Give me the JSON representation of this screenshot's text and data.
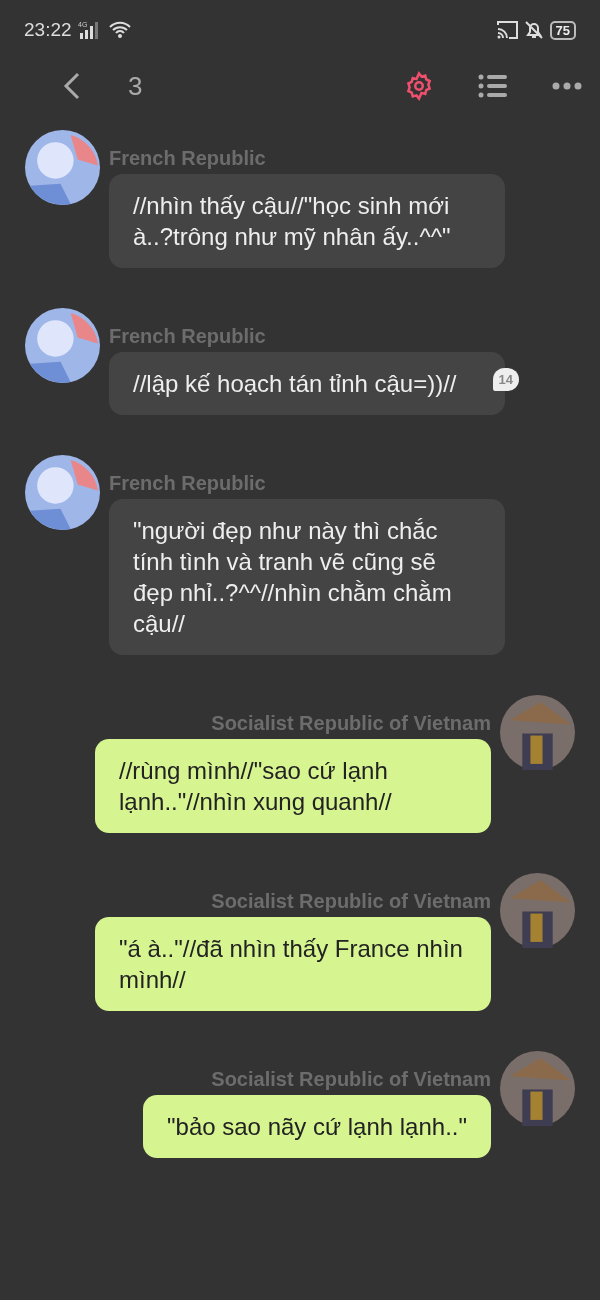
{
  "status_bar": {
    "time": "23:22",
    "network": "4G",
    "battery": "75"
  },
  "toolbar": {
    "title": "3"
  },
  "messages": [
    {
      "kind": "left",
      "sender": "French Republic",
      "text": "//nhìn thấy cậu//\"học sinh mới à..?trông như mỹ nhân ấy..^^\""
    },
    {
      "kind": "left",
      "sender": "French Republic",
      "text": "//lập kế hoạch tán tỉnh cậu=))//",
      "badge": "14"
    },
    {
      "kind": "left",
      "sender": "French Republic",
      "text": "\"người đẹp như này thì chắc tính tình và tranh vẽ cũng sẽ đẹp nhỉ..?^^//nhìn chằm chằm cậu//"
    },
    {
      "kind": "right",
      "sender": "Socialist Republic of Vietnam",
      "text": "//rùng mình//\"sao cứ lạnh lạnh..\"//nhìn xung quanh//"
    },
    {
      "kind": "right",
      "sender": "Socialist Republic of Vietnam",
      "text": "\"á à..\"//đã nhìn thấy France nhìn mình//"
    },
    {
      "kind": "right",
      "sender": "Socialist Republic of Vietnam",
      "text": "\"bảo sao nãy cứ lạnh lạnh..\""
    }
  ]
}
